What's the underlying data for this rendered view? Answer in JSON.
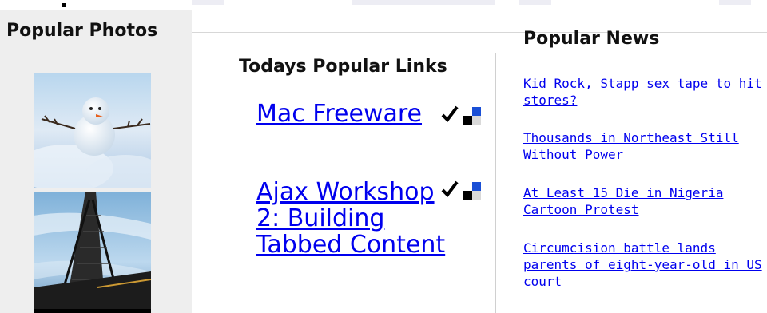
{
  "left": {
    "title": "Popular Photos",
    "photos": [
      {
        "icon": "snowman-photo"
      },
      {
        "icon": "bridge-photo"
      }
    ]
  },
  "middle": {
    "title": "Todays Popular Links",
    "links": [
      {
        "label": "Mac Freeware",
        "icon": "checkmark-rating-icon"
      },
      {
        "label": "Ajax Workshop 2: Building Tabbed Content",
        "icon": "checkmark-rating-icon"
      }
    ]
  },
  "right": {
    "title": "Popular News",
    "items": [
      {
        "label": "Kid Rock, Stapp sex tape to hit stores? "
      },
      {
        "label": "Thousands in Northeast Still Without Power "
      },
      {
        "label": "At Least 15 Die in Nigeria Cartoon Protest "
      },
      {
        "label": "Circumcision battle lands parents of eight-year-old in US court "
      }
    ]
  },
  "colors": {
    "link": "#0000ee",
    "sidebar_bg": "#eeeeee",
    "rating_blue": "#1a4fd6"
  }
}
